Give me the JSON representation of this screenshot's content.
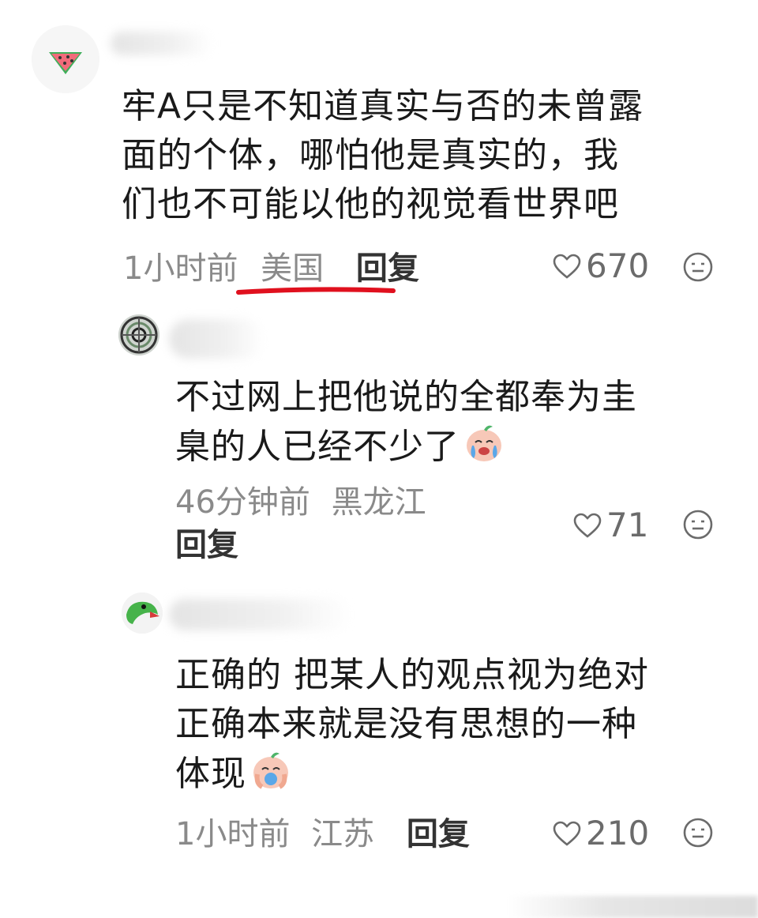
{
  "comments": [
    {
      "text": "牢A只是不知道真实与否的未曾露\n面的个体，哪怕他是真实的，我\n们也不可能以他的视觉看世界吧",
      "time": "1小时前",
      "location": "美国",
      "reply_label": "回复",
      "likes": "670",
      "avatar_icon": "watermelon-icon"
    },
    {
      "text": "不过网上把他说的全都奉为圭\n臬的人已经不少了",
      "emoji": "crying-face-emoji",
      "time": "46分钟前",
      "location": "黑龙江",
      "reply_label": "回复",
      "likes": "71",
      "avatar_icon": "pattern-avatar"
    },
    {
      "text": "正确的 把某人的观点视为绝对\n正确本来就是没有思想的一种\n体现",
      "emoji": "crying-face-emoji",
      "time": "1小时前",
      "location": "江苏",
      "reply_label": "回复",
      "likes": "210",
      "avatar_icon": "green-bird-avatar"
    }
  ],
  "colors": {
    "text": "#1a1a1a",
    "meta": "#8a8a8a",
    "underline": "#e0101e"
  }
}
